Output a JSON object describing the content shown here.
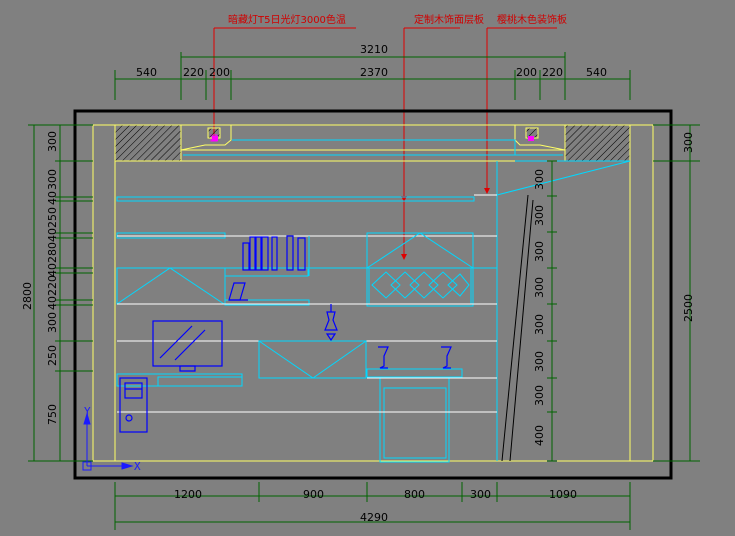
{
  "annotations": [
    "暗藏灯T5日光灯3000色温",
    "定制木饰面层板",
    "樱桃木色装饰板"
  ],
  "top_dims": {
    "total": "3210",
    "segments": [
      "540",
      "220",
      "200",
      "2370",
      "200",
      "220",
      "540"
    ]
  },
  "bottom_dims": {
    "total": "4290",
    "segments": [
      "1200",
      "900",
      "800",
      "300",
      "1090"
    ]
  },
  "left_dims": {
    "total": "2800",
    "segments": [
      "300",
      "300",
      "40",
      "250",
      "40",
      "280",
      "40",
      "220",
      "40",
      "300",
      "250",
      "750"
    ]
  },
  "right_dims": {
    "inner": [
      "300",
      "300",
      "300",
      "300",
      "300",
      "300",
      "300",
      "400"
    ],
    "outer_total": "2500",
    "outer_top": "300"
  },
  "ucs": {
    "x_label": "X",
    "y_label": "Y"
  },
  "colors": {
    "background": "#808080",
    "dimension": "#006400",
    "furniture": "#00d8ff",
    "ceiling": "#ffff66",
    "annotation": "#ff0000",
    "symbols": "#0000ff"
  }
}
